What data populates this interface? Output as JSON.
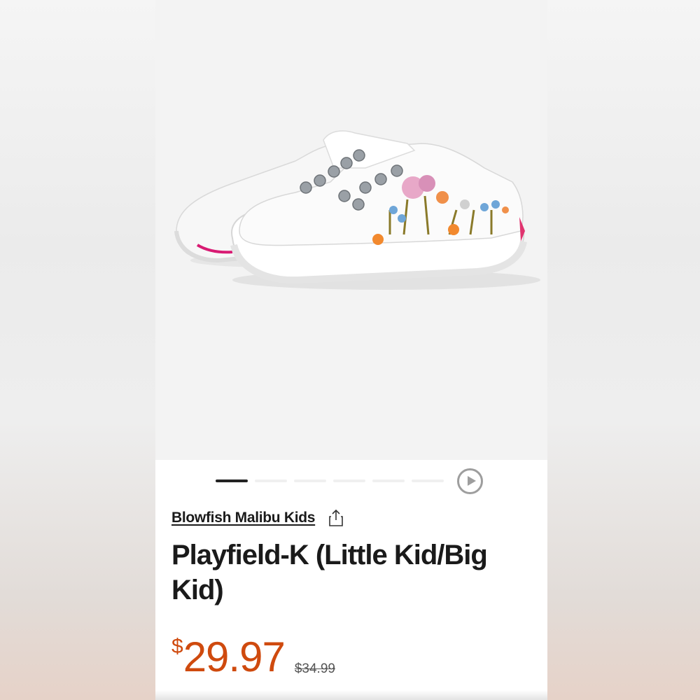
{
  "product": {
    "brand": "Blowfish Malibu Kids",
    "title": "Playfield-K (Little Kid/Big Kid)",
    "price_currency": "$",
    "price": "29.97",
    "original_price": "$34.99"
  },
  "carousel": {
    "total_slides": 6,
    "active_index": 0
  },
  "icons": {
    "share": "share-icon",
    "play": "play-icon"
  },
  "colors": {
    "price": "#cf4a0e",
    "text": "#1a1a1a",
    "active_dot": "#222222"
  }
}
